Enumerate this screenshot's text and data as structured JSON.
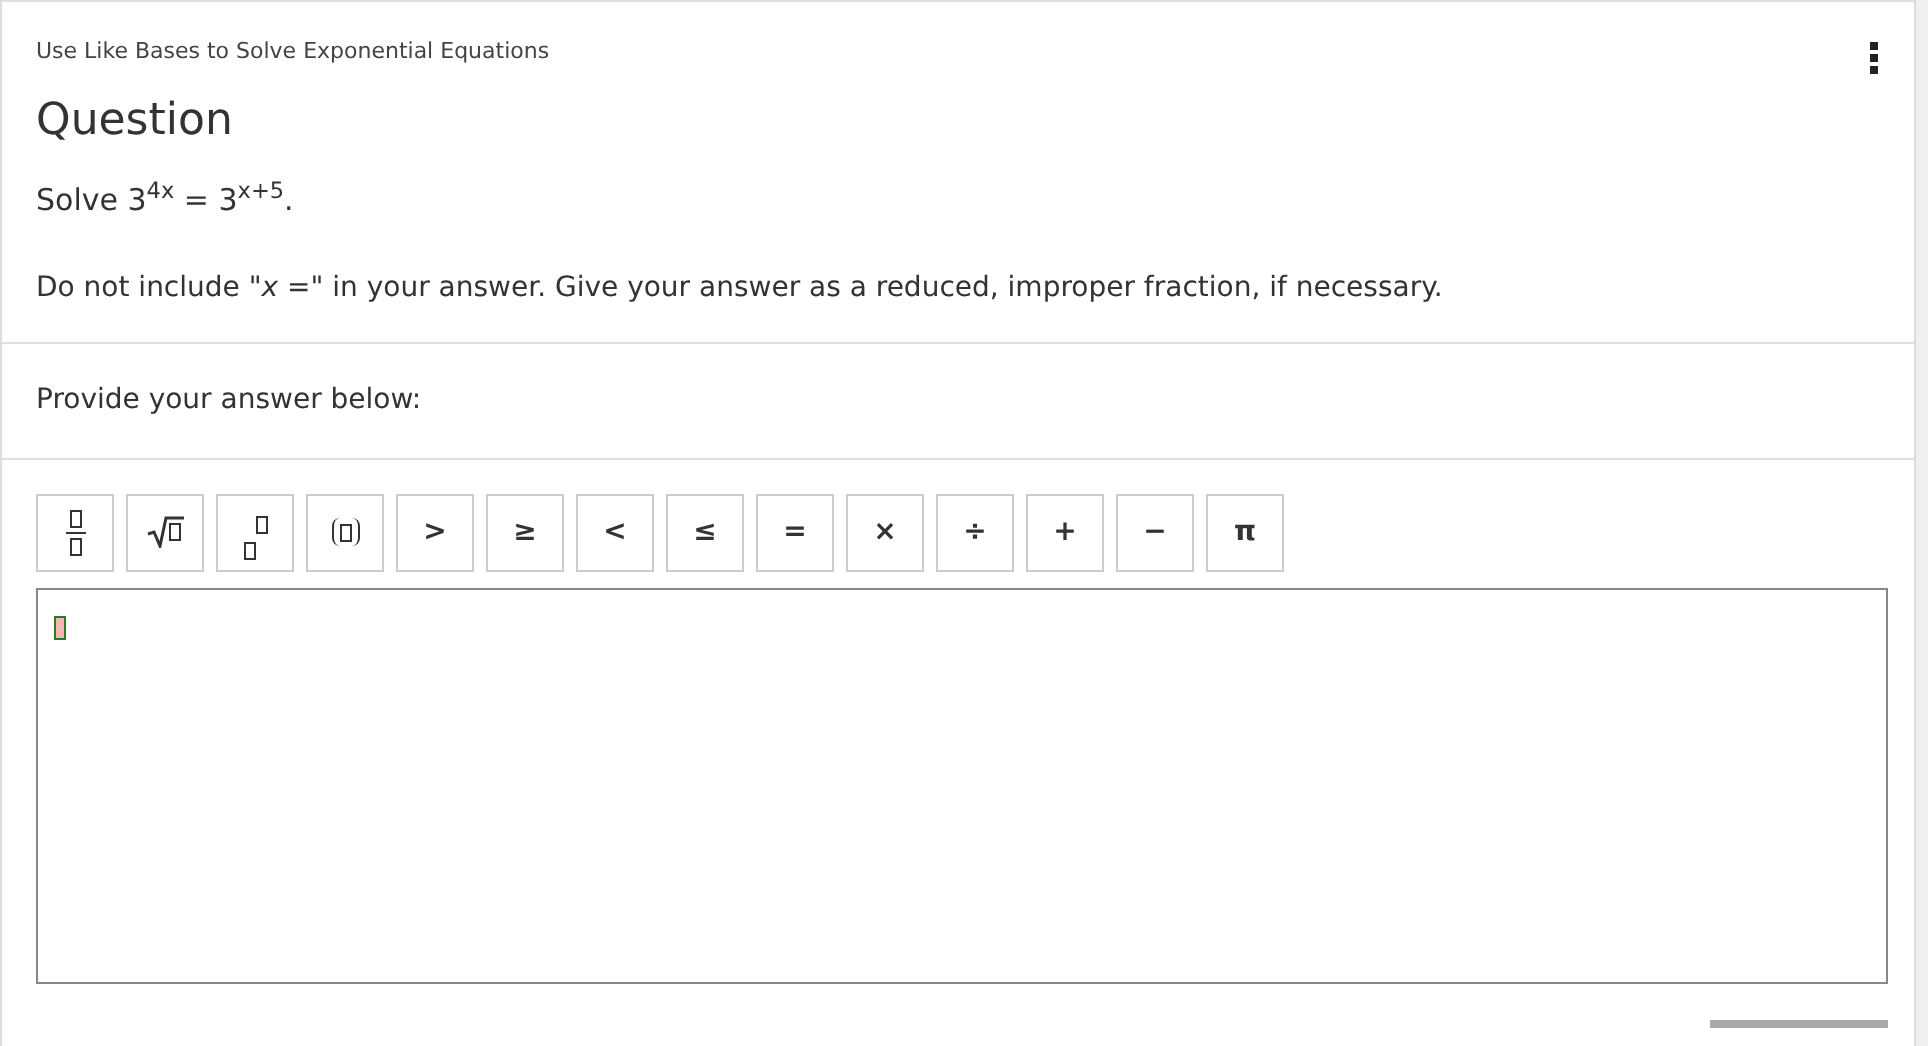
{
  "header": {
    "title": "Use Like Bases to Solve Exponential Equations"
  },
  "question": {
    "heading": "Question",
    "prompt": "Solve 3$^{4x}$ = 3$^{x+5}$.",
    "instructions": "Do not include \"*x* =\" in your answer. Give your answer as a reduced, improper fraction, if necessary."
  },
  "answer": {
    "label": "Provide your answer below:",
    "toolbar": [
      {
        "kind": "fraction"
      },
      {
        "kind": "sqrt"
      },
      {
        "kind": "power"
      },
      {
        "kind": "parens"
      },
      {
        "kind": "symbol",
        "label": ">"
      },
      {
        "kind": "symbol",
        "label": "≥"
      },
      {
        "kind": "symbol",
        "label": "<"
      },
      {
        "kind": "symbol",
        "label": "≤"
      },
      {
        "kind": "symbol",
        "label": "="
      },
      {
        "kind": "symbol",
        "label": "×"
      },
      {
        "kind": "symbol",
        "label": "÷"
      },
      {
        "kind": "symbol",
        "label": "+"
      },
      {
        "kind": "symbol",
        "label": "−"
      },
      {
        "kind": "symbol",
        "label": "π"
      }
    ]
  }
}
